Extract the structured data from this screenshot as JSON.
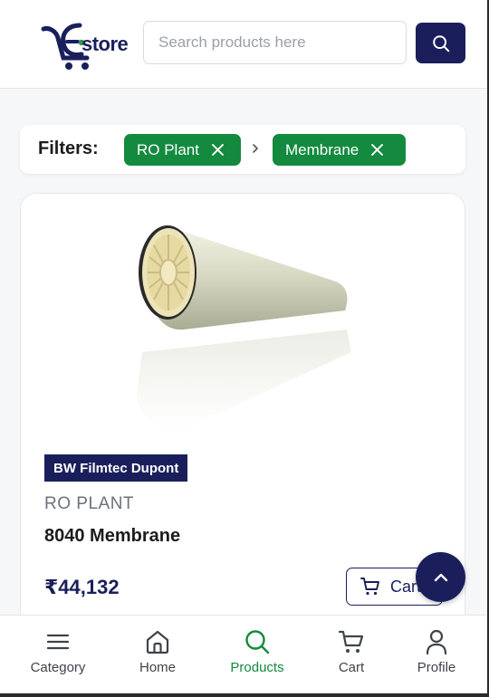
{
  "header": {
    "logo_text": "store",
    "logo_letter": "E",
    "search_placeholder": "Search products here"
  },
  "filters": {
    "label": "Filters:",
    "chips": [
      {
        "label": "RO Plant"
      },
      {
        "label": "Membrane"
      }
    ]
  },
  "product": {
    "brand": "BW Filmtec Dupont",
    "category": "RO PLANT",
    "name": "8040 Membrane",
    "price": "₹44,132",
    "cart_label": "Cart"
  },
  "nav": {
    "items": [
      {
        "label": "Category",
        "icon": "menu-icon"
      },
      {
        "label": "Home",
        "icon": "home-icon"
      },
      {
        "label": "Products",
        "icon": "search-icon",
        "active": true
      },
      {
        "label": "Cart",
        "icon": "cart-icon"
      },
      {
        "label": "Profile",
        "icon": "user-icon"
      }
    ]
  },
  "colors": {
    "brand": "#1a1f5c",
    "accent": "#138a3e"
  }
}
